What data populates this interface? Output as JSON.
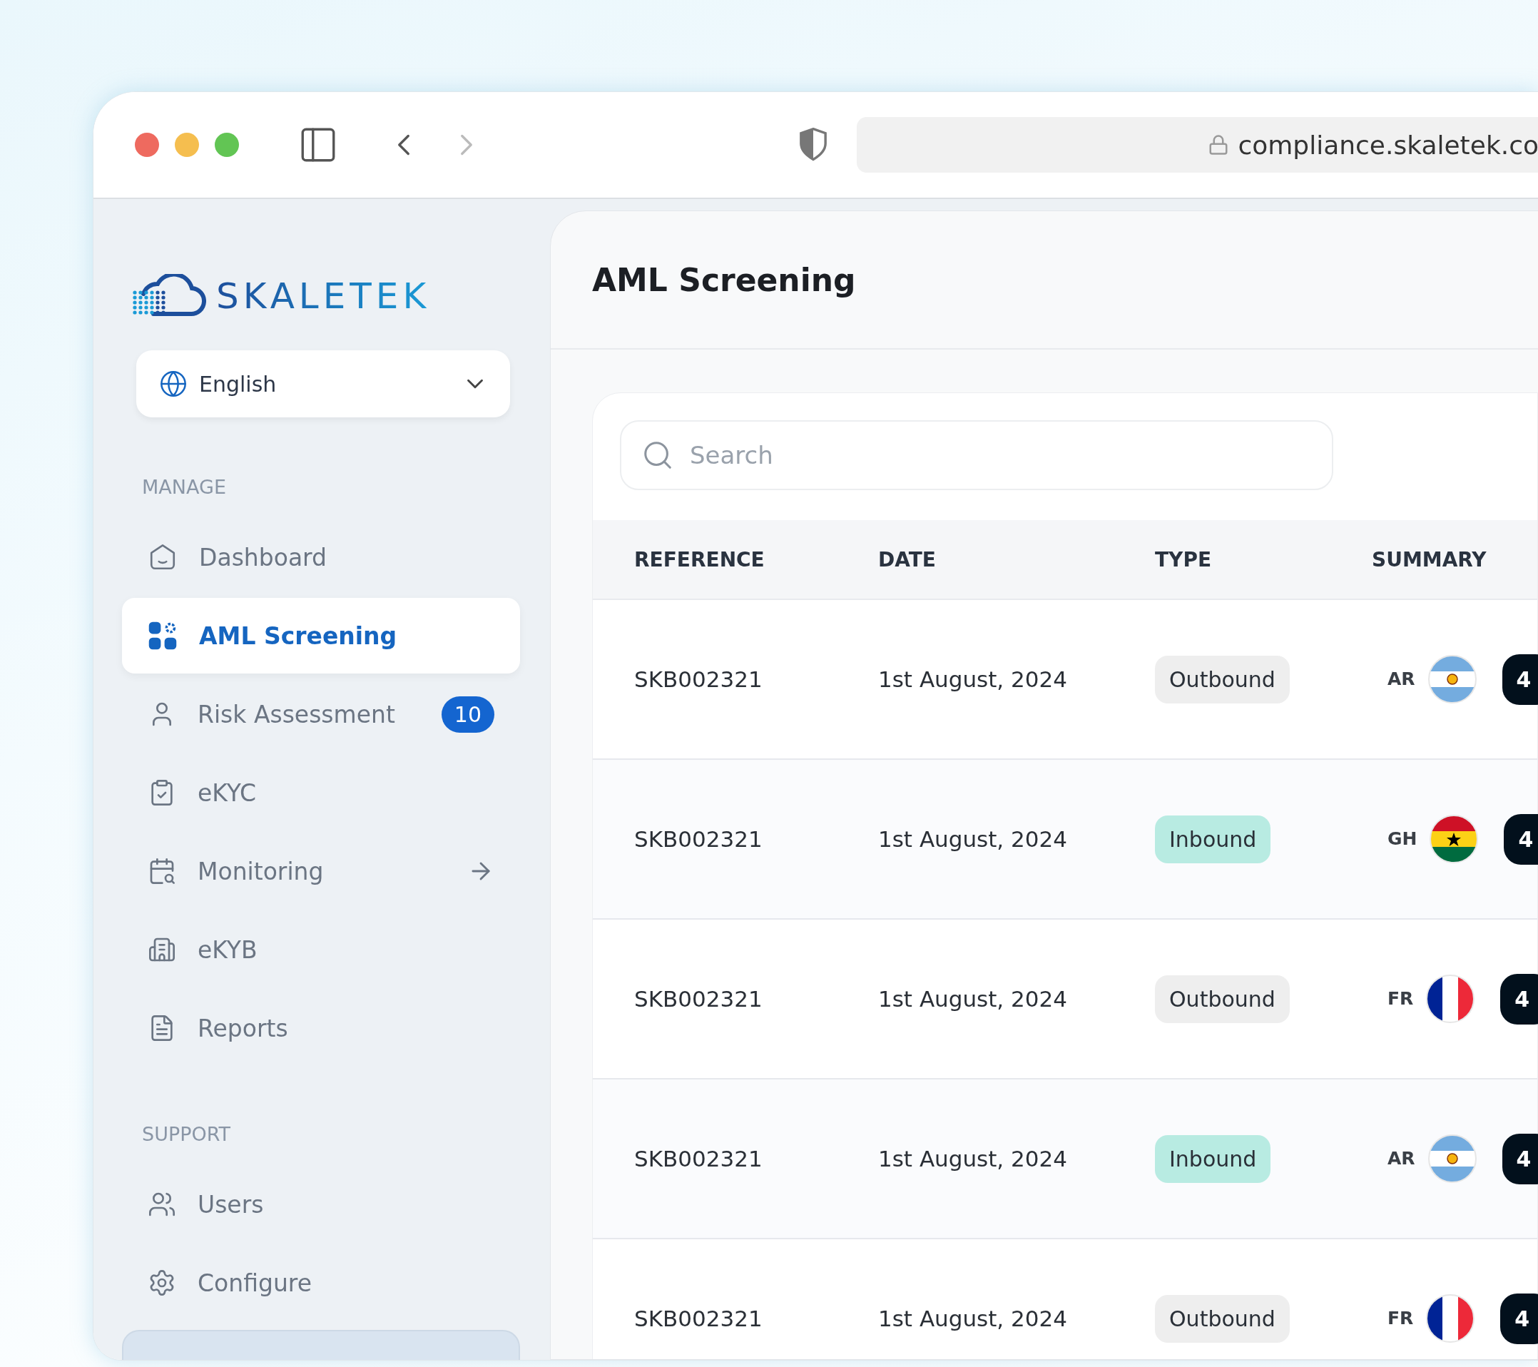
{
  "browser": {
    "url": "compliance.skaletek.co"
  },
  "sidebar": {
    "logo": "SKALETEK",
    "language": "English",
    "sections": [
      {
        "title": "MANAGE",
        "items": [
          {
            "label": "Dashboard",
            "kind": "home",
            "selected": false
          },
          {
            "label": "AML Screening",
            "kind": "apps",
            "selected": true
          },
          {
            "label": "Risk Assessment",
            "kind": "user",
            "selected": false,
            "badge": "10"
          },
          {
            "label": "eKYC",
            "kind": "clipboard",
            "selected": false
          },
          {
            "label": "Monitoring",
            "kind": "monitor",
            "selected": false,
            "arrow": true
          },
          {
            "label": "eKYB",
            "kind": "building",
            "selected": false
          },
          {
            "label": "Reports",
            "kind": "doc",
            "selected": false
          }
        ]
      },
      {
        "title": "SUPPORT",
        "items": [
          {
            "label": "Users",
            "kind": "users",
            "selected": false
          },
          {
            "label": "Configure",
            "kind": "gear",
            "selected": false
          }
        ]
      }
    ]
  },
  "page": {
    "title": "AML Screening",
    "search": {
      "placeholder": "Search"
    }
  },
  "table": {
    "columns": [
      "REFERENCE",
      "DATE",
      "TYPE",
      "SUMMARY"
    ],
    "rows": [
      {
        "reference": "SKB002321",
        "date": "1st August, 2024",
        "type": {
          "label": "Outbound",
          "color": "#eeeeee"
        },
        "country": "AR",
        "kind": "argentina",
        "score": "4"
      },
      {
        "reference": "SKB002321",
        "date": "1st August, 2024",
        "type": {
          "label": "Inbound",
          "color": "#b8ebe2"
        },
        "country": "GH",
        "kind": "ghana",
        "score": "4"
      },
      {
        "reference": "SKB002321",
        "date": "1st August, 2024",
        "type": {
          "label": "Outbound",
          "color": "#eeeeee"
        },
        "country": "FR",
        "kind": "france",
        "score": "4"
      },
      {
        "reference": "SKB002321",
        "date": "1st August, 2024",
        "type": {
          "label": "Inbound",
          "color": "#b8ebe2"
        },
        "country": "AR",
        "kind": "argentina",
        "score": "4"
      },
      {
        "reference": "SKB002321",
        "date": "1st August, 2024",
        "type": {
          "label": "Outbound",
          "color": "#eeeeee"
        },
        "country": "FR",
        "kind": "france",
        "score": "4"
      }
    ]
  }
}
